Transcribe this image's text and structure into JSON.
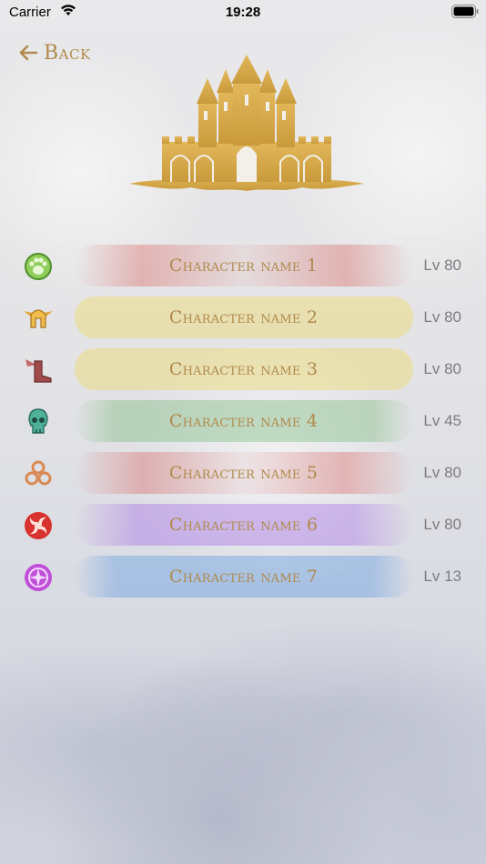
{
  "status_bar": {
    "carrier": "Carrier",
    "time": "19:28"
  },
  "back_button": {
    "label": "Back"
  },
  "accent_color": "#b08a4c",
  "characters": [
    {
      "name": "Character name 1",
      "level": "Lv 80",
      "icon": "paw-icon",
      "color": "#d9534f"
    },
    {
      "name": "Character name 2",
      "level": "Lv 80",
      "icon": "winged-helmet-icon",
      "color": "#f1d64a"
    },
    {
      "name": "Character name 3",
      "level": "Lv 80",
      "icon": "winged-boot-icon",
      "color": "#f1d64a"
    },
    {
      "name": "Character name 4",
      "level": "Lv 45",
      "icon": "skull-icon",
      "color": "#6bb36b"
    },
    {
      "name": "Character name 5",
      "level": "Lv 80",
      "icon": "triquetra-icon",
      "color": "#d9534f"
    },
    {
      "name": "Character name 6",
      "level": "Lv 80",
      "icon": "swirl-icon",
      "color": "#9b59e6"
    },
    {
      "name": "Character name 7",
      "level": "Lv 13",
      "icon": "arcane-sigil-icon",
      "color": "#4a8fe0"
    }
  ]
}
